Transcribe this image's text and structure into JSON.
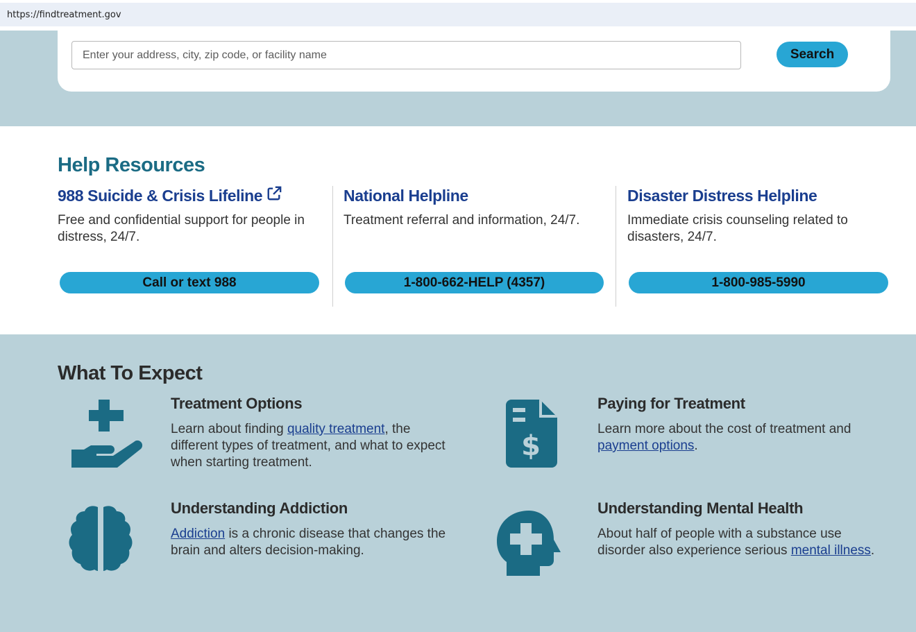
{
  "browser": {
    "url": "https://findtreatment.gov"
  },
  "search": {
    "placeholder": "Enter your address, city, zip code, or facility name",
    "button_label": "Search"
  },
  "help": {
    "title": "Help Resources",
    "resources": [
      {
        "title": "988 Suicide & Crisis Lifeline",
        "description": "Free and confidential support for people in distress, 24/7.",
        "button": "Call or text 988",
        "icon": "external-link-icon"
      },
      {
        "title": "National Helpline",
        "description": "Treatment referral and information, 24/7.",
        "button": "1-800-662-HELP (4357)"
      },
      {
        "title": "Disaster Distress Helpline",
        "description": "Immediate crisis counseling related to disasters, 24/7.",
        "button": "1-800-985-5990"
      }
    ]
  },
  "expect": {
    "title": "What To Expect",
    "items": [
      {
        "title": "Treatment Options",
        "icon": "hand-with-plus-icon",
        "text_before": "Learn about finding ",
        "link": "quality treatment",
        "text_after": ", the different types of treatment, and what to expect when starting treatment."
      },
      {
        "title": "Paying for Treatment",
        "icon": "invoice-dollar-icon",
        "text_before": "Learn more about the cost of treatment and ",
        "link": "payment options",
        "text_after": "."
      },
      {
        "title": "Understanding Addiction",
        "icon": "brain-icon",
        "text_before": "",
        "link": "Addiction",
        "text_after": " is a chronic disease that changes the brain and alters decision-making."
      },
      {
        "title": "Understanding Mental Health",
        "icon": "head-with-plus-icon",
        "text_before": "About half of people with a substance use disorder also experience serious ",
        "link": "mental illness",
        "text_after": "."
      }
    ]
  },
  "colors": {
    "band": "#b9d1d9",
    "accent_button": "#28a6d4",
    "heading_teal": "#1b6b84",
    "link_blue": "#1a3e8f",
    "icon_teal": "#1b6b84"
  }
}
